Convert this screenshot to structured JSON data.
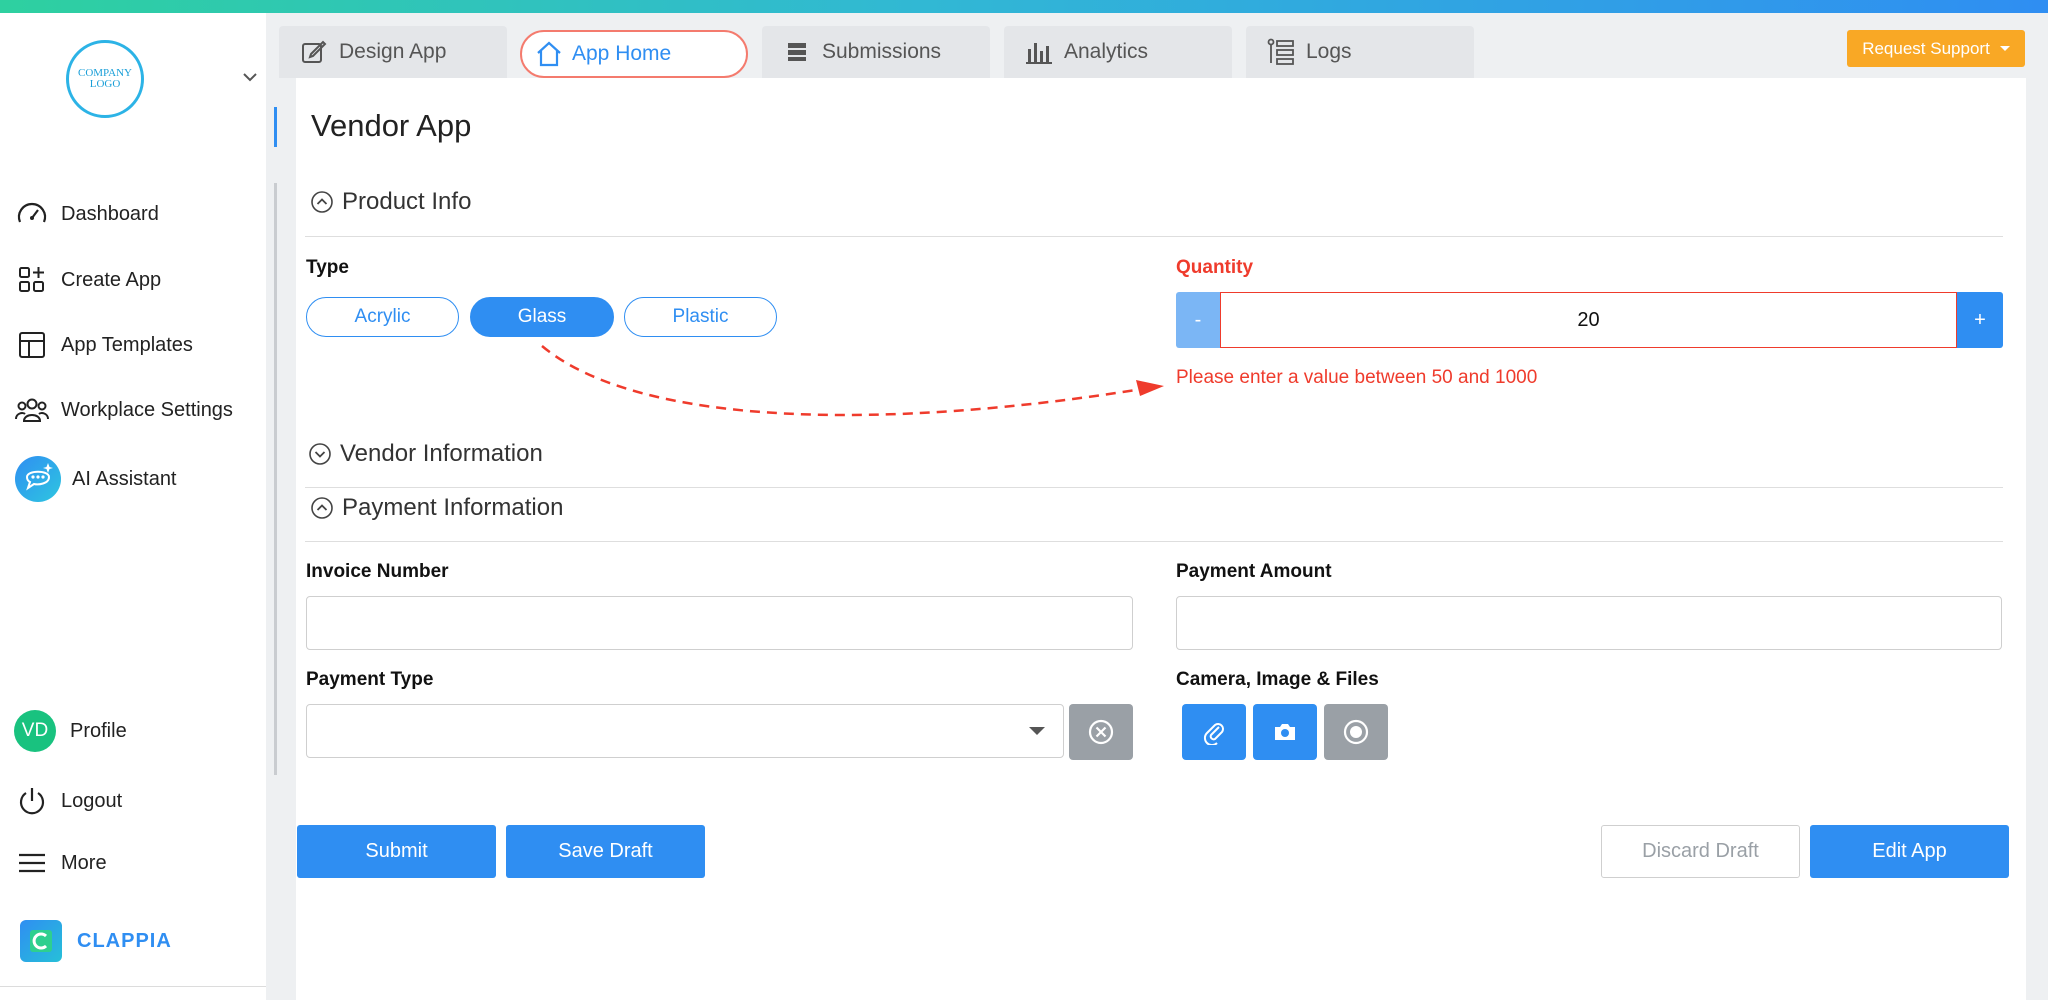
{
  "sidebar": {
    "logo_text": "COMPANY LOGO",
    "items": [
      {
        "label": "Dashboard",
        "icon": "dashboard-gauge-icon"
      },
      {
        "label": "Create App",
        "icon": "create-app-grid-icon"
      },
      {
        "label": "App Templates",
        "icon": "templates-layout-icon"
      },
      {
        "label": "Workplace Settings",
        "icon": "users-group-icon"
      },
      {
        "label": "AI Assistant",
        "icon": "ai-chat-icon"
      }
    ],
    "profile": {
      "initials": "VD",
      "label": "Profile"
    },
    "logout_label": "Logout",
    "more_label": "More",
    "brand": "CLAPPIA"
  },
  "tabs": [
    {
      "label": "Design App",
      "icon": "edit-icon"
    },
    {
      "label": "App Home",
      "icon": "home-icon"
    },
    {
      "label": "Submissions",
      "icon": "list-icon"
    },
    {
      "label": "Analytics",
      "icon": "bar-chart-icon"
    },
    {
      "label": "Logs",
      "icon": "logs-icon"
    }
  ],
  "support_label": "Request Support",
  "page_title": "Vendor App",
  "sections": {
    "product": "Product Info",
    "vendor": "Vendor Information",
    "payment": "Payment Information"
  },
  "product": {
    "type_label": "Type",
    "type_options": [
      "Acrylic",
      "Glass",
      "Plastic"
    ],
    "type_selected": "Glass",
    "quantity_label": "Quantity",
    "quantity_value": "20",
    "minus_label": "-",
    "plus_label": "+",
    "quantity_error": "Please enter a value between 50 and 1000"
  },
  "payment": {
    "invoice_label": "Invoice Number",
    "invoice_value": "",
    "amount_label": "Payment Amount",
    "amount_value": "",
    "type_label": "Payment Type",
    "type_value": "",
    "media_label": "Camera, Image & Files"
  },
  "actions": {
    "submit": "Submit",
    "save_draft": "Save Draft",
    "discard_draft": "Discard Draft",
    "edit_app": "Edit App"
  },
  "colors": {
    "accent": "#2f8ef2",
    "error": "#ef3b2c",
    "support": "#f9a825",
    "active_tab_border": "#f47b6e"
  }
}
